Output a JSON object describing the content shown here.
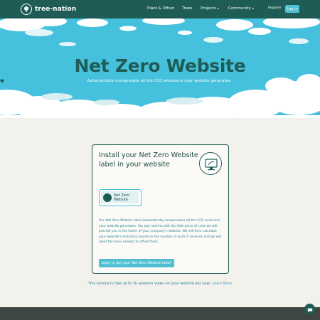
{
  "nav": {
    "logo_text": "tree-nation",
    "plant_offset": "Plant & Offset",
    "trees": "Trees",
    "projects": "Projects",
    "community": "Community",
    "register": "Register",
    "login": "Log In"
  },
  "hero": {
    "title": "Net Zero Website",
    "subtitle": "Automatically compensate all the CO2 emissions your website generates"
  },
  "card": {
    "title": "Install your Net Zero Website label in your website",
    "label_text_line1": "Net Zero",
    "label_text_line2": "Website",
    "description": "Our Net Zero Website label automatically compensates all the CO2 emissions your website generates. You just need to add the little piece of code we will provide you in the footer of your company's website. We will then calculate your website's emissions based on the number of visits it receives and we will plant the trees needed to offset them.",
    "cta": "Login to get your Net Zero Website label!"
  },
  "note": {
    "text": "This service is free up to 1k sessions views on your website per year.",
    "learn_more": "Learn More"
  },
  "colors": {
    "brand_dark": "#1f5c55",
    "sky": "#46c1dd",
    "accent": "#4fc0d3",
    "background": "#f3f1ec",
    "footer": "#3e4744"
  },
  "icons": [
    "tree-logo-icon",
    "chevron-down-icon",
    "heart-icon",
    "monitor-icon",
    "chat-icon"
  ]
}
